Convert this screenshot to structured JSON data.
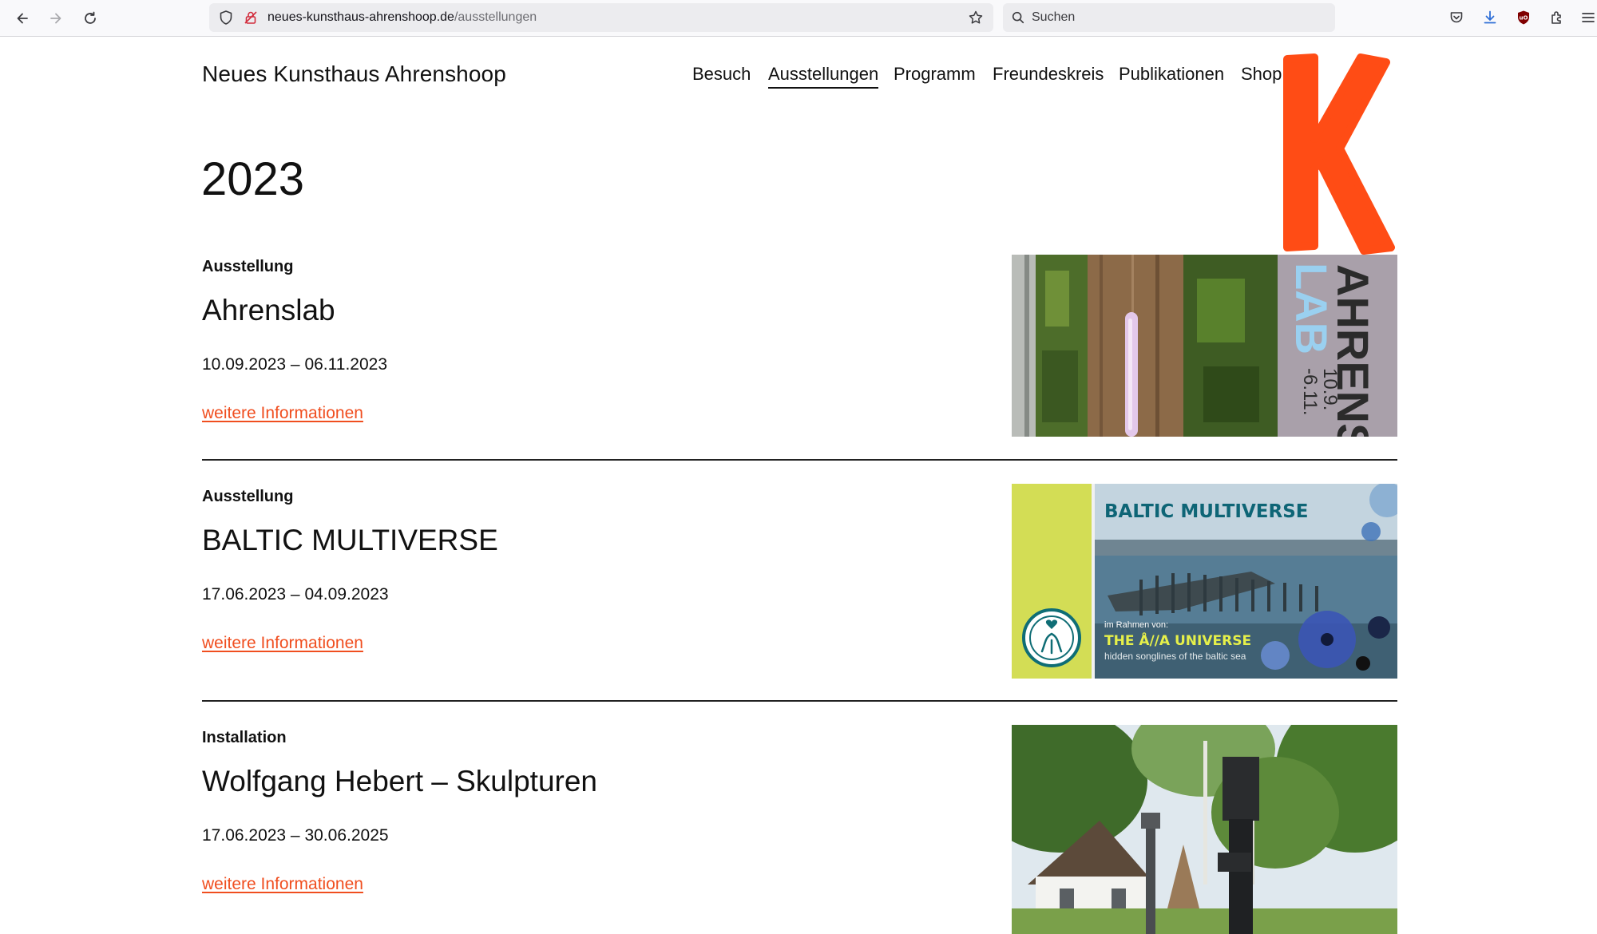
{
  "browser": {
    "url_domain": "neues-kunsthaus-ahrenshoop.de",
    "url_path": "/ausstellungen",
    "search_placeholder": "Suchen",
    "icons": [
      "back-arrow-icon",
      "forward-arrow-icon",
      "reload-icon",
      "shield-icon",
      "lock-icon",
      "bookmark-star-icon",
      "search-icon",
      "pocket-icon",
      "download-icon",
      "ublock-icon",
      "extensions-icon",
      "menu-icon"
    ]
  },
  "site": {
    "title": "Neues Kunsthaus Ahrenshoop",
    "brand_color": "#ff4c15",
    "link_color": "#f04e1f",
    "nav": [
      {
        "label": "Besuch",
        "active": false
      },
      {
        "label": "Ausstellungen",
        "active": true
      },
      {
        "label": "Programm",
        "active": false
      },
      {
        "label": "Freundeskreis",
        "active": false
      },
      {
        "label": "Publikationen",
        "active": false
      },
      {
        "label": "Shop",
        "active": false
      }
    ],
    "logo_letter": "K"
  },
  "main": {
    "year": "2023",
    "entries": [
      {
        "kind": "Ausstellung",
        "title": "Ahrenslab",
        "dates": "10.09.2023 – 06.11.2023",
        "link": "weitere Informationen",
        "image_text": {
          "word1": "AHRENS",
          "word2": "LAB",
          "date_line1": "10.9.",
          "date_line2": "-6.11."
        }
      },
      {
        "kind": "Ausstellung",
        "title": "BALTIC MULTIVERSE",
        "dates": "17.06.2023 – 04.09.2023",
        "link": "weitere Informationen",
        "image_text": {
          "headline": "BALTIC MULTIVERSE",
          "small": "im Rahmen von:",
          "universe": "THE Å//A UNIVERSE",
          "sub": "hidden songlines of the baltic sea"
        }
      },
      {
        "kind": "Installation",
        "title": "Wolfgang Hebert – Skulpturen",
        "dates": "17.06.2023 – 30.06.2025",
        "link": "weitere Informationen"
      }
    ]
  }
}
